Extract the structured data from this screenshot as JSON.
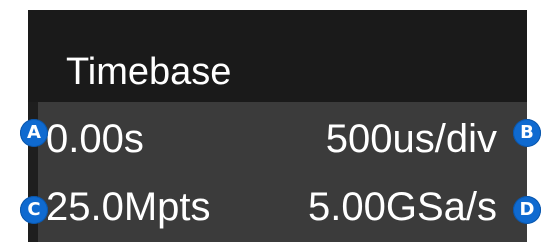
{
  "panel": {
    "title": "Timebase",
    "trigger_delay": "0.00s",
    "timebase_scale": "500us/div",
    "memory_depth": "25.0Mpts",
    "sample_rate": "5.00GSa/s"
  },
  "markers": {
    "a": "A",
    "b": "B",
    "c": "C",
    "d": "D"
  },
  "colors": {
    "panel_bg": "#1e1e1e",
    "body_bg": "#3b3b3b",
    "marker_blue": "#0f6ad0",
    "text": "#ffffff"
  }
}
